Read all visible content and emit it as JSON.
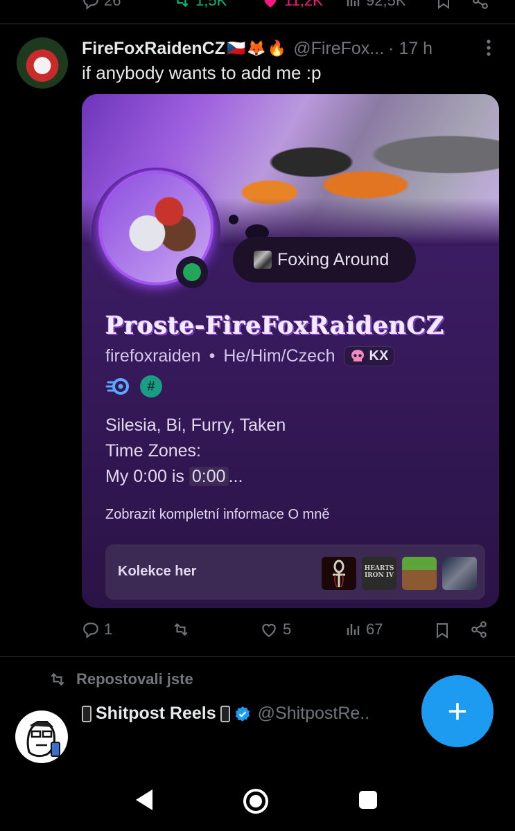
{
  "top_stats": {
    "replies": "26",
    "reposts": "1,5K",
    "likes": "11,2K",
    "views": "92,5K"
  },
  "tweet": {
    "display_name": "FireFoxRaidenCZ",
    "name_emojis": [
      "🇨🇿",
      "🦊",
      "🔥"
    ],
    "handle": "@FireFox...",
    "time": "· 17 h",
    "text": "if anybody wants to add me :p",
    "stats": {
      "replies": "1",
      "reposts": "",
      "likes": "5",
      "views": "67"
    }
  },
  "profile_card": {
    "status": "Foxing Around",
    "display_name": "Proste-FireFoxRaidenCZ",
    "username": "firefoxraiden",
    "separator": "•",
    "pronouns": "He/Him/Czech",
    "clan_tag": "KX",
    "bio_lines": [
      "Silesia, Bi, Furry, Taken",
      "Time Zones:"
    ],
    "bio_time_prefix": "My 0:00 is",
    "bio_time_value": "0:00",
    "bio_time_suffix": "...",
    "show_more": "Zobrazit kompletní informace O mně",
    "games_label": "Kolekce her",
    "game2_text": "HEARTS IRON IV",
    "online_color": "#23a55a"
  },
  "retweet": {
    "label": "Repostovali jste",
    "display_name": "Shitpost Reels",
    "handle": "@ShitpostRe.."
  },
  "fab_label": "+",
  "colors": {
    "accent": "#1d9bf0",
    "like": "#f91880",
    "repost": "#00ba7c",
    "muted": "#71767b"
  }
}
